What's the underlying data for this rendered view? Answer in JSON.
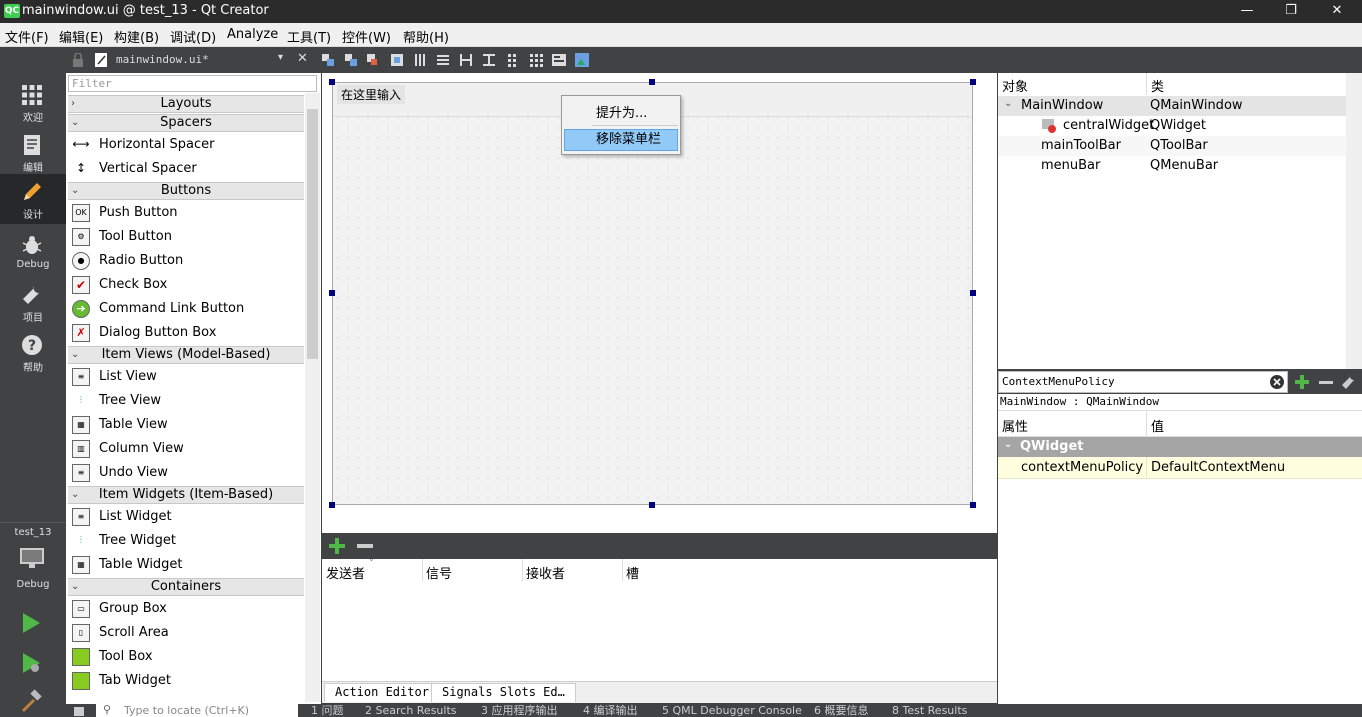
{
  "window": {
    "icon_text": "QC",
    "title": "mainwindow.ui @ test_13 - Qt Creator",
    "minimize": "—",
    "maximize": "❐",
    "close": "✕"
  },
  "menu": [
    "文件(F)",
    "编辑(E)",
    "构建(B)",
    "调试(D)",
    "Analyze",
    "工具(T)",
    "控件(W)",
    "帮助(H)"
  ],
  "modes": [
    {
      "label": "欢迎",
      "icon": "grid-icon"
    },
    {
      "label": "编辑",
      "icon": "document-icon"
    },
    {
      "label": "设计",
      "icon": "pencil-icon"
    },
    {
      "label": "Debug",
      "icon": "bug-icon"
    },
    {
      "label": "项目",
      "icon": "wrench-icon"
    },
    {
      "label": "帮助",
      "icon": "help-icon"
    }
  ],
  "kit": {
    "project": "test_13",
    "config": "Debug"
  },
  "editor_toolbar": {
    "file": "mainwindow.ui*",
    "close": "✕"
  },
  "widget_box": {
    "filter_placeholder": "Filter",
    "layouts": "Layouts",
    "spacers": {
      "title": "Spacers",
      "items": [
        "Horizontal Spacer",
        "Vertical Spacer"
      ]
    },
    "buttons": {
      "title": "Buttons",
      "items": [
        "Push Button",
        "Tool Button",
        "Radio Button",
        "Check Box",
        "Command Link Button",
        "Dialog Button Box"
      ]
    },
    "item_views": {
      "title": "Item Views (Model-Based)",
      "items": [
        "List View",
        "Tree View",
        "Table View",
        "Column View",
        "Undo View"
      ]
    },
    "item_widgets": {
      "title": "Item Widgets (Item-Based)",
      "items": [
        "List Widget",
        "Tree Widget",
        "Table Widget"
      ]
    },
    "containers": {
      "title": "Containers",
      "items": [
        "Group Box",
        "Scroll Area",
        "Tool Box",
        "Tab Widget"
      ]
    }
  },
  "form": {
    "type_here": "在这里输入"
  },
  "context_menu": {
    "promote": "提升为...",
    "remove_menubar": "移除菜单栏"
  },
  "signals_slots": {
    "headers": [
      "发送者",
      "信号",
      "接收者",
      "槽"
    ],
    "tabs": [
      "Action Editor",
      "Signals  Slots Ed…"
    ]
  },
  "object_inspector": {
    "headers": [
      "对象",
      "类"
    ],
    "rows": [
      {
        "name": "MainWindow",
        "cls": "QMainWindow"
      },
      {
        "name": "centralWidget",
        "cls": "QWidget"
      },
      {
        "name": "mainToolBar",
        "cls": "QToolBar"
      },
      {
        "name": "menuBar",
        "cls": "QMenuBar"
      }
    ]
  },
  "property_editor": {
    "filter": "ContextMenuPolicy",
    "class_line": "MainWindow : QMainWindow",
    "headers": [
      "属性",
      "值"
    ],
    "group": "QWidget",
    "row": {
      "name": "contextMenuPolicy",
      "value": "DefaultContextMenu"
    }
  },
  "status": {
    "locator_placeholder": "Type to locate (Ctrl+K)",
    "panes": [
      "1 问题",
      "2 Search Results",
      "3 应用程序输出",
      "4 编译输出",
      "5 QML Debugger Console",
      "6 概要信息",
      "8 Test Results"
    ]
  },
  "colors": {
    "accent": "#41cd52",
    "selection": "#91c9f7",
    "handle": "#000080"
  }
}
